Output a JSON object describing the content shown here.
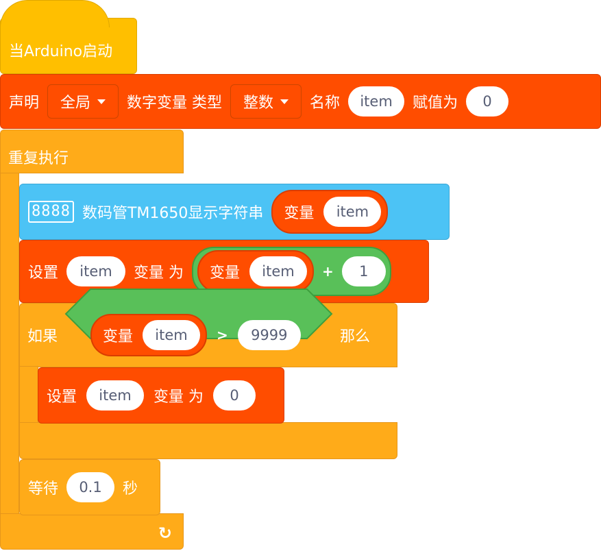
{
  "hat": {
    "label": "当Arduino启动"
  },
  "declare": {
    "label": "声明",
    "scope": "全局",
    "text_type": "数字变量 类型",
    "type": "整数",
    "text_name": "名称",
    "name": "item",
    "text_assign": "赋值为",
    "value": "0"
  },
  "forever": {
    "label": "重复执行"
  },
  "display": {
    "icon_text": "8888",
    "label": "数码管TM1650显示字符串",
    "var_label": "变量",
    "var_name": "item"
  },
  "set1": {
    "label": "设置",
    "var": "item",
    "text_to": "变量 为",
    "add_var_label": "变量",
    "add_var_name": "item",
    "op": "+",
    "add_value": "1"
  },
  "if_block": {
    "label": "如果",
    "var_label": "变量",
    "var_name": "item",
    "op": ">",
    "value": "9999",
    "then_label": "那么"
  },
  "set2": {
    "label": "设置",
    "var": "item",
    "text_to": "变量 为",
    "value": "0"
  },
  "wait": {
    "label": "等待",
    "value": "0.1",
    "unit": "秒"
  },
  "colors": {
    "hat": "#ffbf00",
    "variable": "#ff4d00",
    "control": "#ffab19",
    "display": "#4cc3f5",
    "operator": "#59c059"
  }
}
